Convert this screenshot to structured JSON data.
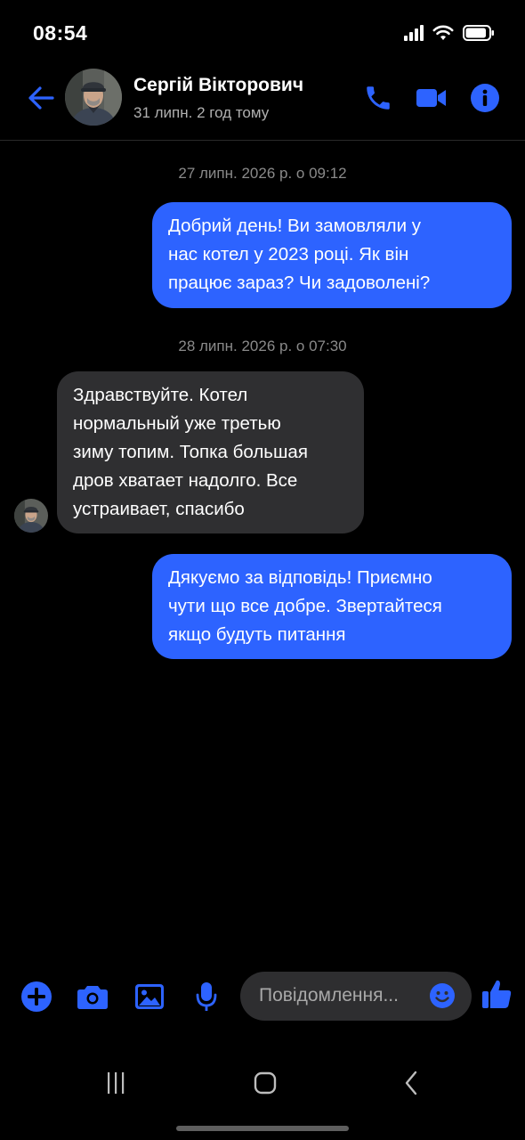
{
  "status_bar": {
    "time": "08:54",
    "battery_level": 0.9
  },
  "header": {
    "back_icon": "arrow-left-icon",
    "contact_name": "Сергій Вікторович",
    "last_seen": "31 липн. 2 год тому",
    "call_icon": "phone-icon",
    "video_icon": "video-camera-icon",
    "info_icon": "info-icon"
  },
  "messages": [
    {
      "type": "timestamp",
      "text": "27 липн. 2026 р. о 09:12"
    },
    {
      "type": "outgoing",
      "lines": [
        "Добрий день! Ви замовляли у",
        "нас котел у 2023 році. Як він",
        "працює зараз? Чи задоволені?"
      ]
    },
    {
      "type": "timestamp",
      "text": "28 липн. 2026 р. о 07:30"
    },
    {
      "type": "incoming",
      "lines": [
        "Здравствуйте. Котел",
        "нормальный уже третью",
        "зиму топим. Топка большая",
        "дров хватает надолго. Все",
        "устраивает, спасибо"
      ]
    },
    {
      "type": "outgoing",
      "lines": [
        "Дякуємо за відповідь! Приємно",
        "чути що все добре. Звертайтеся",
        "якщо будуть питання"
      ]
    }
  ],
  "composer": {
    "placeholder": "Повідомлення...",
    "icons": [
      "plus-icon",
      "camera-icon",
      "image-icon",
      "microphone-icon",
      "emoji-icon",
      "thumbs-up-icon"
    ]
  },
  "colors": {
    "accent": "#2d63ff",
    "incoming_bubble": "#2f2f31",
    "background": "#000000"
  }
}
